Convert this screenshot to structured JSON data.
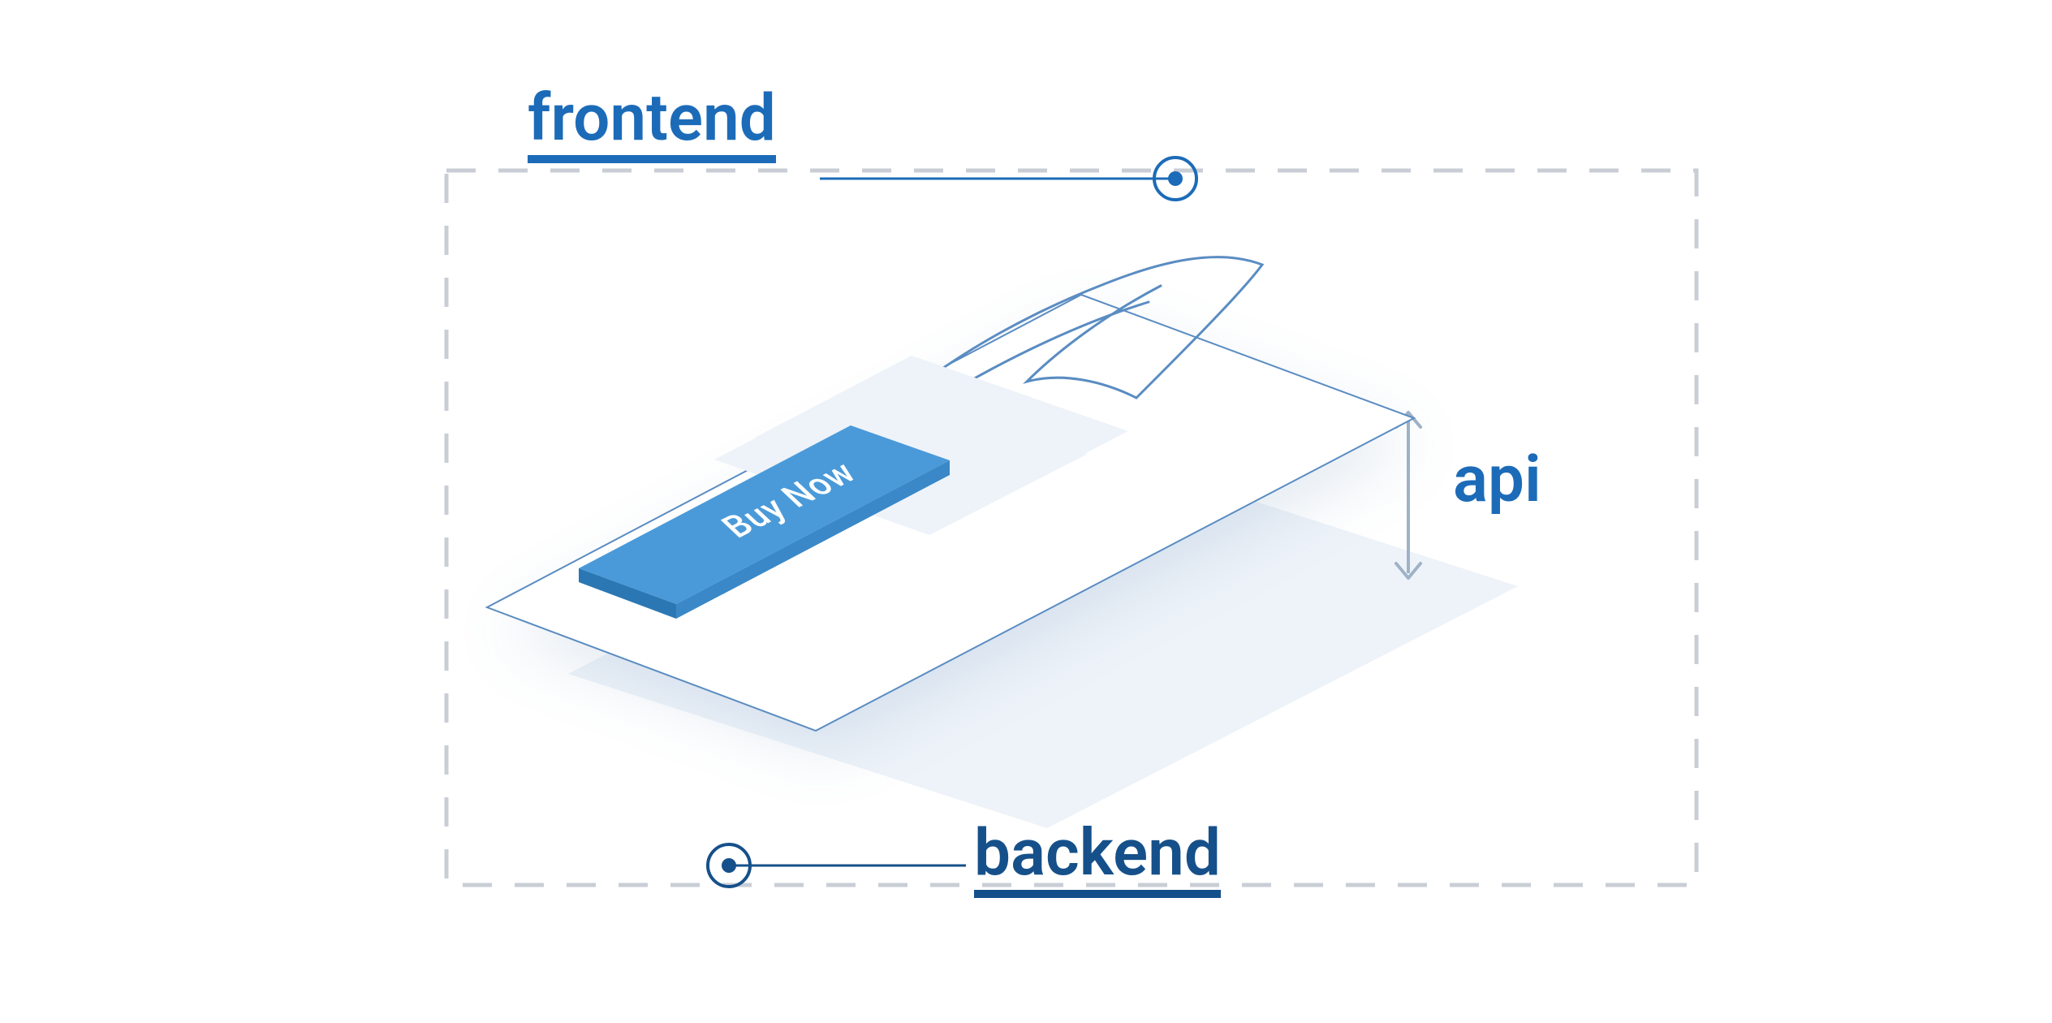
{
  "labels": {
    "frontend": "frontend",
    "backend": "backend",
    "api": "api"
  },
  "card": {
    "button_label": "Buy Now"
  },
  "colors": {
    "accent_blue": "#1c6bb8",
    "dark_blue": "#16508a",
    "button_blue": "#4a9ad9",
    "light_panel": "#eef3f9",
    "dash_gray": "#c9ced6"
  }
}
